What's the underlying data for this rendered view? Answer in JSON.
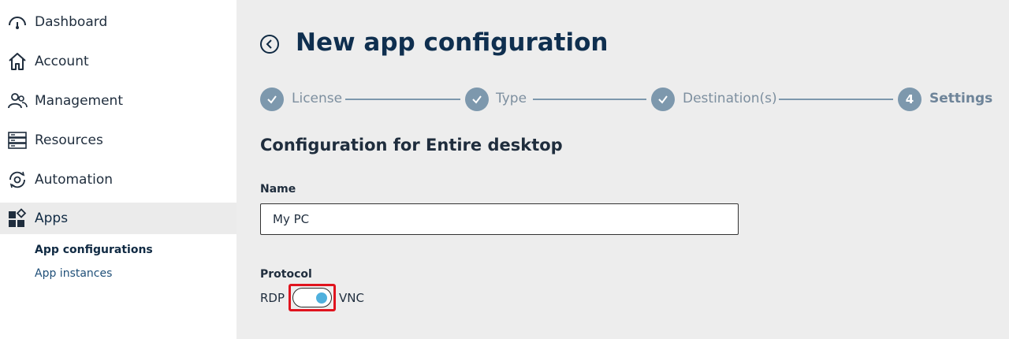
{
  "sidebar": {
    "items": [
      {
        "label": "Dashboard",
        "icon": "gauge-icon"
      },
      {
        "label": "Account",
        "icon": "home-icon"
      },
      {
        "label": "Management",
        "icon": "users-icon"
      },
      {
        "label": "Resources",
        "icon": "server-icon"
      },
      {
        "label": "Automation",
        "icon": "automation-gear-icon"
      },
      {
        "label": "Apps",
        "icon": "apps-icon",
        "active": true
      }
    ],
    "sub_items": [
      {
        "label": "App configurations",
        "active": true
      },
      {
        "label": "App instances"
      }
    ]
  },
  "header": {
    "title": "New app configuration"
  },
  "stepper": {
    "steps": [
      {
        "label": "License",
        "state": "done"
      },
      {
        "label": "Type",
        "state": "done"
      },
      {
        "label": "Destination(s)",
        "state": "done"
      },
      {
        "label": "Settings",
        "state": "current",
        "number": "4"
      }
    ]
  },
  "form": {
    "section_title": "Configuration for Entire desktop",
    "name_label": "Name",
    "name_value": "My PC",
    "protocol_label": "Protocol",
    "protocol_left": "RDP",
    "protocol_right": "VNC",
    "protocol_selected": "VNC"
  },
  "colors": {
    "accent": "#4fb0dd",
    "step": "#7d98ad",
    "title": "#0f2f4f",
    "highlight": "#e0141e"
  }
}
